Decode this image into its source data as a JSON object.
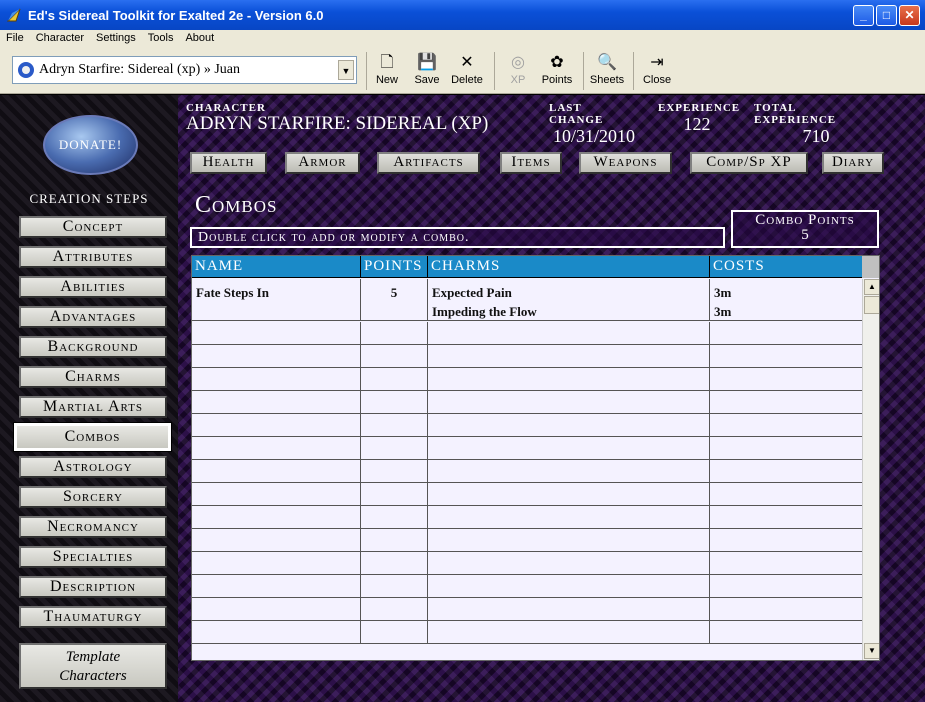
{
  "window": {
    "title": "Ed's Sidereal Toolkit for Exalted 2e - Version 6.0",
    "minimize": "_",
    "maximize": "□",
    "close": "✕"
  },
  "menu": [
    "File",
    "Character",
    "Settings",
    "Tools",
    "About"
  ],
  "toolbar": {
    "character_select": "Adryn Starfire: Sidereal (xp) » Juan",
    "buttons": [
      {
        "label": "New",
        "icon": "🗋"
      },
      {
        "label": "Save",
        "icon": "💾"
      },
      {
        "label": "Delete",
        "icon": "✕"
      },
      {
        "label": "XP",
        "icon": "◎"
      },
      {
        "label": "Points",
        "icon": "✿"
      },
      {
        "label": "Sheets",
        "icon": "🔍"
      },
      {
        "label": "Close",
        "icon": "⇥"
      }
    ]
  },
  "donate": "DONATE!",
  "creation_steps_title": "CREATION STEPS",
  "creation_steps": [
    "Concept",
    "Attributes",
    "Abilities",
    "Advantages",
    "Background",
    "Charms",
    "Martial Arts",
    "Combos",
    "Astrology",
    "Sorcery",
    "Necromancy",
    "Specialties",
    "Description",
    "Thaumaturgy"
  ],
  "active_step": "Combos",
  "template_characters": {
    "line1": "Template",
    "line2": "Characters"
  },
  "header": {
    "character_label": "CHARACTER",
    "character_value": "ADRYN STARFIRE: SIDEREAL (XP)",
    "last_change_label": "LAST CHANGE",
    "last_change_value": "10/31/2010",
    "experience_label": "EXPERIENCE",
    "experience_value": "122",
    "total_experience_label": "TOTAL EXPERIENCE",
    "total_experience_value": "710"
  },
  "nav": [
    "Health",
    "Armor",
    "Artifacts",
    "Items",
    "Weapons",
    "Comp/Sp XP",
    "Diary"
  ],
  "panel": {
    "title": "Combos",
    "instructions": "Double click to add or modify a combo.",
    "combo_points_label": "Combo Points",
    "combo_points_value": "5"
  },
  "grid": {
    "columns": [
      "NAME",
      "POINTS",
      "CHARMS",
      "COSTS"
    ],
    "rows": [
      {
        "name": "Fate Steps In",
        "points": "5",
        "charms": [
          "Expected Pain",
          "Impeding the Flow"
        ],
        "costs": [
          "3m",
          "3m"
        ]
      }
    ],
    "scroll_up": "▲",
    "scroll_down": "▼"
  },
  "colors": {
    "grid_header": "#1a8ac8",
    "titlebar": "#0a50d8",
    "background_purple": "#1a0a2a"
  }
}
